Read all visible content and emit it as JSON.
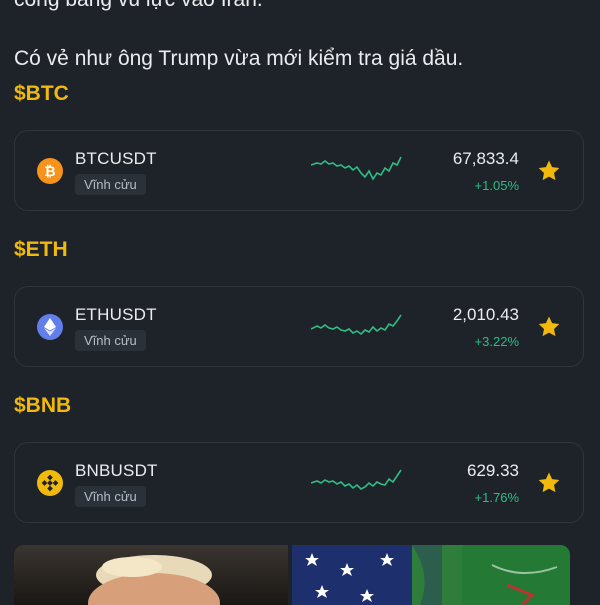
{
  "post": {
    "cut_line": "công bằng vũ lực vào Iran.",
    "line2": "Có vẻ như ông Trump vừa mới kiểm tra giá dầu."
  },
  "colors": {
    "accent": "#f0b90b",
    "up": "#2ebd85",
    "bg": "#1e2329"
  },
  "coins": [
    {
      "tag": "$BTC",
      "symbol": "BTCUSDT",
      "badge": "Vĩnh cửu",
      "price": "67,833.4",
      "change": "+1.05%",
      "icon": "bitcoin-icon",
      "icon_color": "#f7931a"
    },
    {
      "tag": "$ETH",
      "symbol": "ETHUSDT",
      "badge": "Vĩnh cửu",
      "price": "2,010.43",
      "change": "+3.22%",
      "icon": "ethereum-icon",
      "icon_color": "#627eea"
    },
    {
      "tag": "$BNB",
      "symbol": "BNBUSDT",
      "badge": "Vĩnh cửu",
      "price": "629.33",
      "change": "+1.76%",
      "icon": "bnb-icon",
      "icon_color": "#f0b90b"
    }
  ]
}
